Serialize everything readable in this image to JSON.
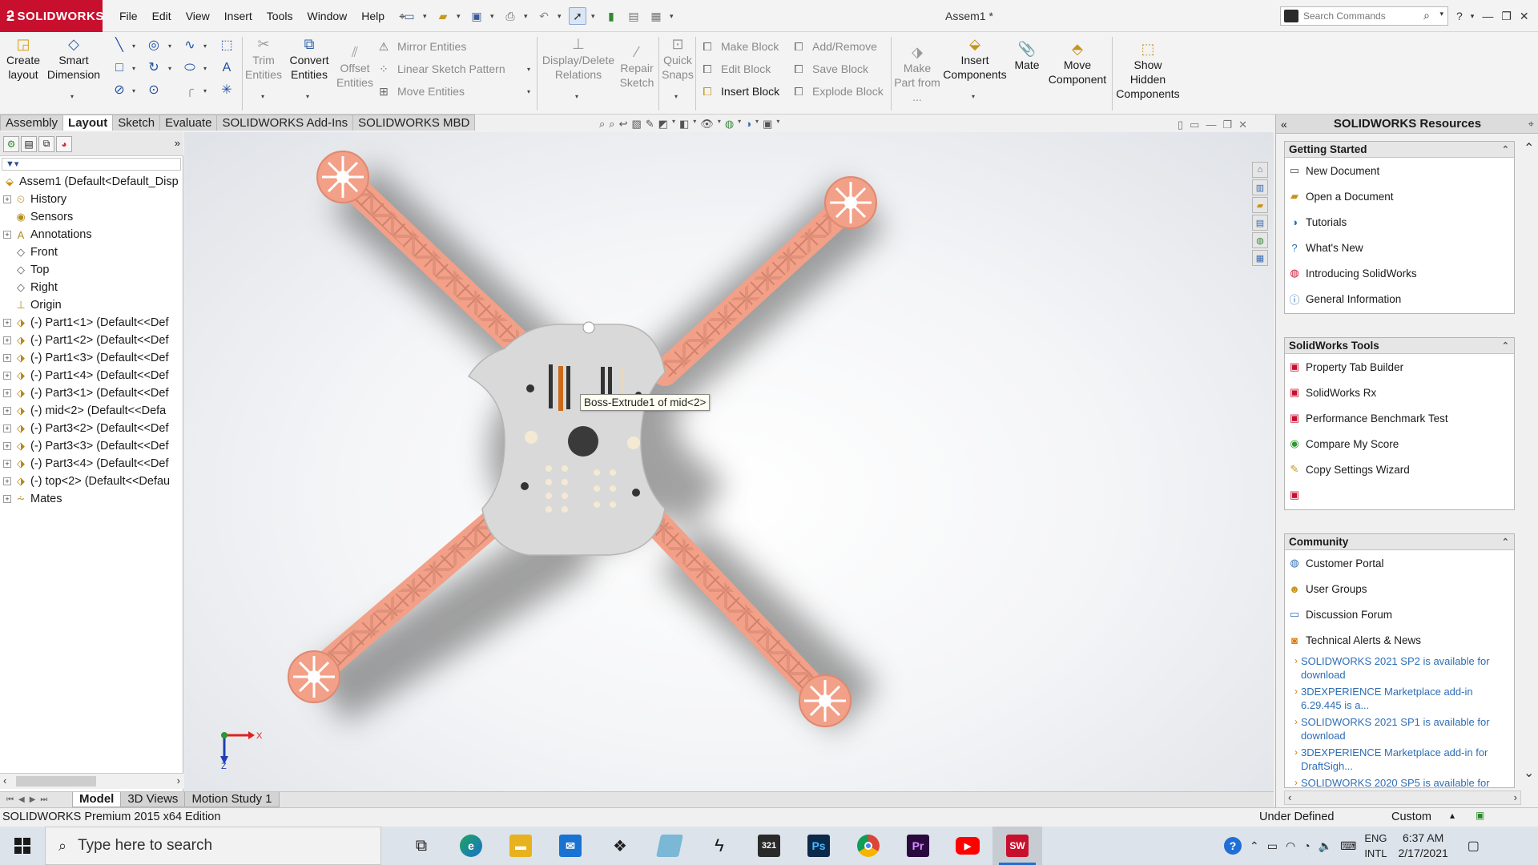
{
  "app": {
    "logo_text": "SOLIDWORKS",
    "window_title": "Assem1 *",
    "menu": [
      "File",
      "Edit",
      "View",
      "Insert",
      "Tools",
      "Window",
      "Help"
    ],
    "search_placeholder": "Search Commands",
    "brand_color": "#c8102e"
  },
  "ribbon": {
    "create_layout": "Create layout",
    "smart_dimension": "Smart Dimension",
    "trim_entities": "Trim Entities",
    "convert_entities": "Convert Entities",
    "offset_entities": "Offset Entities",
    "mirror_entities": "Mirror Entities",
    "linear_sketch_pattern": "Linear Sketch Pattern",
    "move_entities": "Move Entities",
    "display_delete_relations": "Display/Delete Relations",
    "repair_sketch": "Repair Sketch",
    "quick_snaps": "Quick Snaps",
    "make_block": "Make Block",
    "edit_block": "Edit Block",
    "insert_block": "Insert Block",
    "add_remove": "Add/Remove",
    "save_block": "Save Block",
    "explode_block": "Explode Block",
    "make_part_from": "Make Part from ...",
    "insert_components": "Insert Components",
    "mate": "Mate",
    "move_component": "Move Component",
    "show_hidden_components": "Show Hidden Components"
  },
  "tabs": [
    "Assembly",
    "Layout",
    "Sketch",
    "Evaluate",
    "SOLIDWORKS Add-Ins",
    "SOLIDWORKS MBD"
  ],
  "active_tab": "Layout",
  "tree": {
    "root": "Assem1  (Default<Default_Disp",
    "items": [
      {
        "label": "History",
        "icon": "history-icon",
        "expand": true
      },
      {
        "label": "Sensors",
        "icon": "sensors-icon",
        "expand": false
      },
      {
        "label": "Annotations",
        "icon": "annotations-icon",
        "expand": true
      },
      {
        "label": "Front",
        "icon": "plane-icon",
        "expand": false
      },
      {
        "label": "Top",
        "icon": "plane-icon",
        "expand": false
      },
      {
        "label": "Right",
        "icon": "plane-icon",
        "expand": false
      },
      {
        "label": "Origin",
        "icon": "origin-icon",
        "expand": false
      },
      {
        "label": "(-) Part1<1> (Default<<Def",
        "icon": "part-icon",
        "expand": true
      },
      {
        "label": "(-) Part1<2> (Default<<Def",
        "icon": "part-icon",
        "expand": true
      },
      {
        "label": "(-) Part1<3> (Default<<Def",
        "icon": "part-icon",
        "expand": true
      },
      {
        "label": "(-) Part1<4> (Default<<Def",
        "icon": "part-icon",
        "expand": true
      },
      {
        "label": "(-) Part3<1> (Default<<Def",
        "icon": "part-icon",
        "expand": true
      },
      {
        "label": "(-) mid<2> (Default<<Defa",
        "icon": "part-icon",
        "expand": true
      },
      {
        "label": "(-) Part3<2> (Default<<Def",
        "icon": "part-icon",
        "expand": true
      },
      {
        "label": "(-) Part3<3> (Default<<Def",
        "icon": "part-icon",
        "expand": true
      },
      {
        "label": "(-) Part3<4> (Default<<Def",
        "icon": "part-icon",
        "expand": true
      },
      {
        "label": "(-) top<2> (Default<<Defau",
        "icon": "part-icon",
        "expand": true
      },
      {
        "label": "Mates",
        "icon": "mates-icon",
        "expand": true
      }
    ]
  },
  "graphics": {
    "tooltip": "Boss-Extrude1 of mid<2>",
    "arm_color": "#f2a088",
    "plate_color": "#d9d9d9",
    "triad": {
      "x": "X",
      "z": "Z"
    }
  },
  "bottom_tabs": [
    "Model",
    "3D Views",
    "Motion Study 1"
  ],
  "active_bottom_tab": "Model",
  "taskpane": {
    "title": "SOLIDWORKS Resources",
    "getting_started": {
      "title": "Getting Started",
      "items": [
        "New Document",
        "Open a Document",
        "Tutorials",
        "What's New",
        "Introducing SolidWorks",
        "General Information"
      ]
    },
    "tools": {
      "title": "SolidWorks Tools",
      "items": [
        "Property Tab Builder",
        "SolidWorks Rx",
        "Performance Benchmark Test",
        "Compare My Score",
        "Copy Settings Wizard",
        ""
      ]
    },
    "community": {
      "title": "Community",
      "items": [
        "Customer Portal",
        "User Groups",
        "Discussion Forum",
        "Technical Alerts & News"
      ],
      "news": [
        "SOLIDWORKS 2021 SP2 is available for download",
        "3DEXPERIENCE Marketplace add-in 6.29.445 is a...",
        "SOLIDWORKS 2021 SP1 is available for download",
        "3DEXPERIENCE Marketplace add-in for DraftSigh...",
        "SOLIDWORKS 2020 SP5 is available for"
      ]
    }
  },
  "status": {
    "edition": "SOLIDWORKS Premium 2015 x64 Edition",
    "state": "Under Defined",
    "units": "Custom"
  },
  "taskbar": {
    "search_placeholder": "Type here to search",
    "lang_top": "ENG",
    "lang_bottom": "INTL",
    "time": "6:37 AM",
    "date": "2/17/2021"
  }
}
